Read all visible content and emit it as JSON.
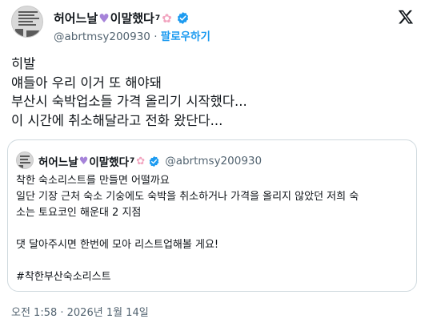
{
  "tweet": {
    "display_name": "허어느날",
    "name_suffix": "이말했다",
    "name_sup": "7",
    "heart_icon": "purple-heart",
    "flower_icon": "cherry-blossom",
    "handle": "@abrtmsy200930",
    "separator": "·",
    "follow_label": "팔로우하기",
    "lines": [
      "히발",
      "얘들아 우리 이거 또 해야돼",
      "부산시 숙박업소들 가격 올리기 시작했다...",
      "이 시간에 취소해달라고 전화 왔단다..."
    ],
    "timestamp": "오전 1:58 · 2026년 1월 14일"
  },
  "quote": {
    "display_name": "허어느날",
    "name_suffix": "이말했다",
    "name_sup": "7",
    "handle": "@abrtmsy200930",
    "line1": "착한 숙소리스트를 만들면 어떨까요",
    "line2": "일단 기장 근처 숙소 기숭에도 숙박을 취소하거나 가격을 올리지 않았던 저희 숙",
    "line3": "소는 토요코인 해운대 2 지점",
    "line4": "댓 달아주시면 한번에 모아 리스트업해볼 게요!",
    "line5": "#착한부산숙소리스트"
  },
  "colors": {
    "accent": "#1d9bf0",
    "verified": "#1d9bf0",
    "heart": "#a683d9",
    "flower": "#f2a5c0",
    "muted": "#536471",
    "border": "#cfd9de"
  }
}
